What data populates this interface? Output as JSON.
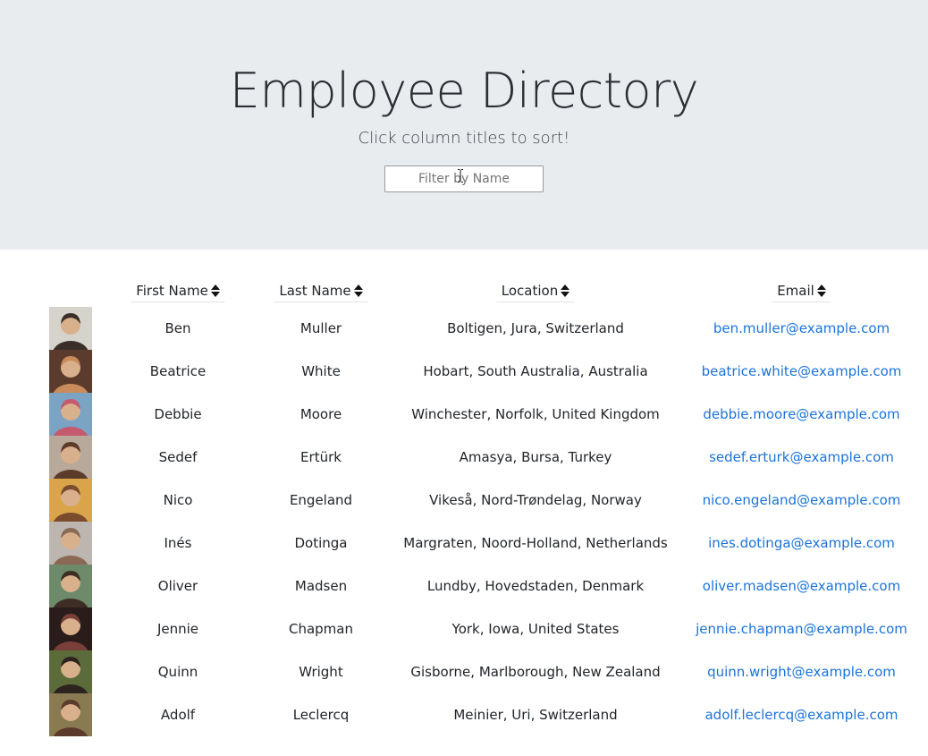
{
  "header": {
    "title": "Employee Directory",
    "subtitle": "Click column titles to sort!",
    "filter_placeholder": "Filter by Name"
  },
  "columns": [
    "First Name",
    "Last Name",
    "Location",
    "Email"
  ],
  "employees": [
    {
      "first": "Ben",
      "last": "Muller",
      "location": "Boltigen, Jura, Switzerland",
      "email": "ben.muller@example.com",
      "avatar_bg": "#d6d2cc",
      "avatar_fg": "#3a2f28"
    },
    {
      "first": "Beatrice",
      "last": "White",
      "location": "Hobart, South Australia, Australia",
      "email": "beatrice.white@example.com",
      "avatar_bg": "#5a3b2c",
      "avatar_fg": "#c98a5c"
    },
    {
      "first": "Debbie",
      "last": "Moore",
      "location": "Winchester, Norfolk, United Kingdom",
      "email": "debbie.moore@example.com",
      "avatar_bg": "#7aa3c4",
      "avatar_fg": "#c45a6e"
    },
    {
      "first": "Sedef",
      "last": "Ertürk",
      "location": "Amasya, Bursa, Turkey",
      "email": "sedef.erturk@example.com",
      "avatar_bg": "#b9a99a",
      "avatar_fg": "#5b3b2a"
    },
    {
      "first": "Nico",
      "last": "Engeland",
      "location": "Vikeså, Nord-Trøndelag, Norway",
      "email": "nico.engeland@example.com",
      "avatar_bg": "#d9a44a",
      "avatar_fg": "#7a4b2c"
    },
    {
      "first": "Inés",
      "last": "Dotinga",
      "location": "Margraten, Noord-Holland, Netherlands",
      "email": "ines.dotinga@example.com",
      "avatar_bg": "#bdb6b0",
      "avatar_fg": "#8a6a55"
    },
    {
      "first": "Oliver",
      "last": "Madsen",
      "location": "Lundby, Hovedstaden, Denmark",
      "email": "oliver.madsen@example.com",
      "avatar_bg": "#6d8a6a",
      "avatar_fg": "#3d2d24"
    },
    {
      "first": "Jennie",
      "last": "Chapman",
      "location": "York, Iowa, United States",
      "email": "jennie.chapman@example.com",
      "avatar_bg": "#2a1c1a",
      "avatar_fg": "#7a3f38"
    },
    {
      "first": "Quinn",
      "last": "Wright",
      "location": "Gisborne, Marlborough, New Zealand",
      "email": "quinn.wright@example.com",
      "avatar_bg": "#5c6b3a",
      "avatar_fg": "#2d2420"
    },
    {
      "first": "Adolf",
      "last": "Leclercq",
      "location": "Meinier, Uri, Switzerland",
      "email": "adolf.leclercq@example.com",
      "avatar_bg": "#8a7a52",
      "avatar_fg": "#5b3b2a"
    }
  ],
  "colors": {
    "hero_bg": "#e9ecef",
    "link": "#1a73d9",
    "text": "#212529"
  }
}
